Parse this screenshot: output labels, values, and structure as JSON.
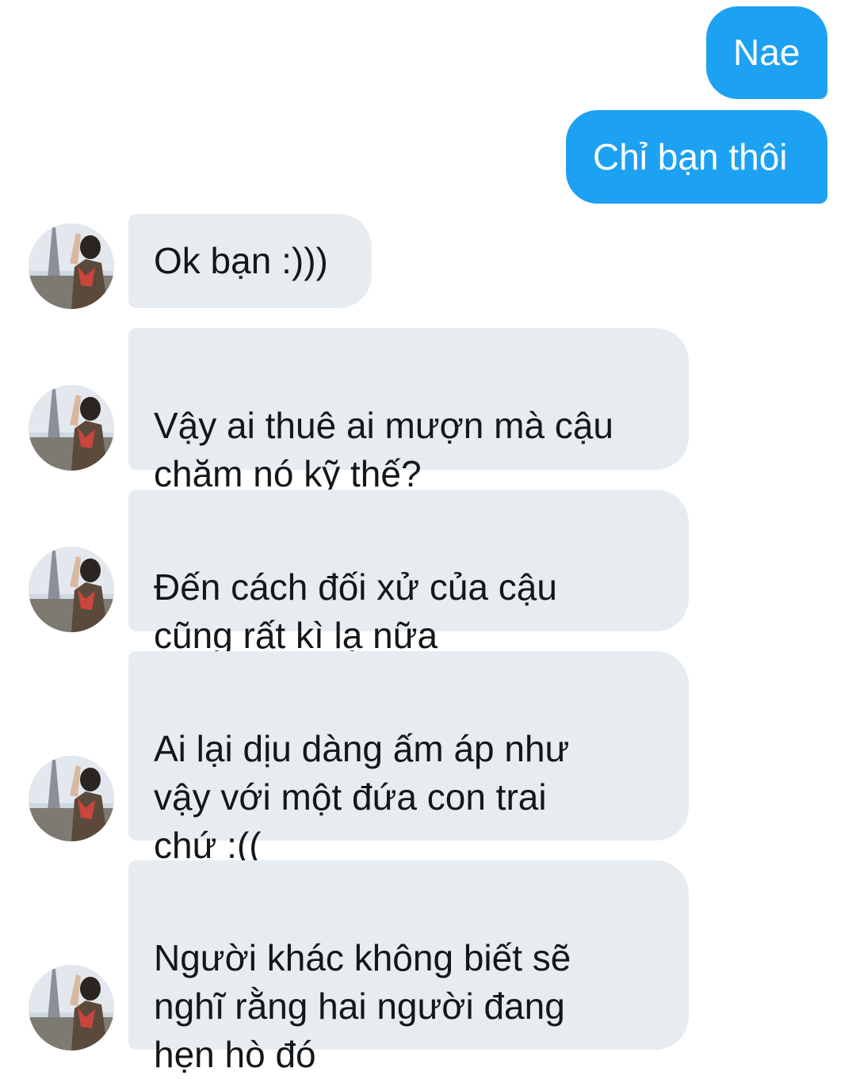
{
  "conversation": {
    "sent_messages": [
      {
        "text": "Nae"
      },
      {
        "text": "Chỉ bạn thôi"
      }
    ],
    "received_messages": [
      {
        "text": "Ok bạn :)))"
      },
      {
        "text": "Vậy ai thuê ai mượn mà cậu\nchăm nó kỹ thế?"
      },
      {
        "text": "Đến cách đối xử của cậu\ncũng rất kì lạ nữa"
      },
      {
        "text": "Ai lại dịu dàng ấm áp như\nvậy với một đứa con trai\nchứ :(("
      },
      {
        "text": "Người khác không biết sẽ\nnghĩ rằng hai người đang\nhẹn hò đó"
      }
    ]
  },
  "colors": {
    "sent_bubble": "#1da1f2",
    "received_bubble": "#e6ecf0"
  }
}
